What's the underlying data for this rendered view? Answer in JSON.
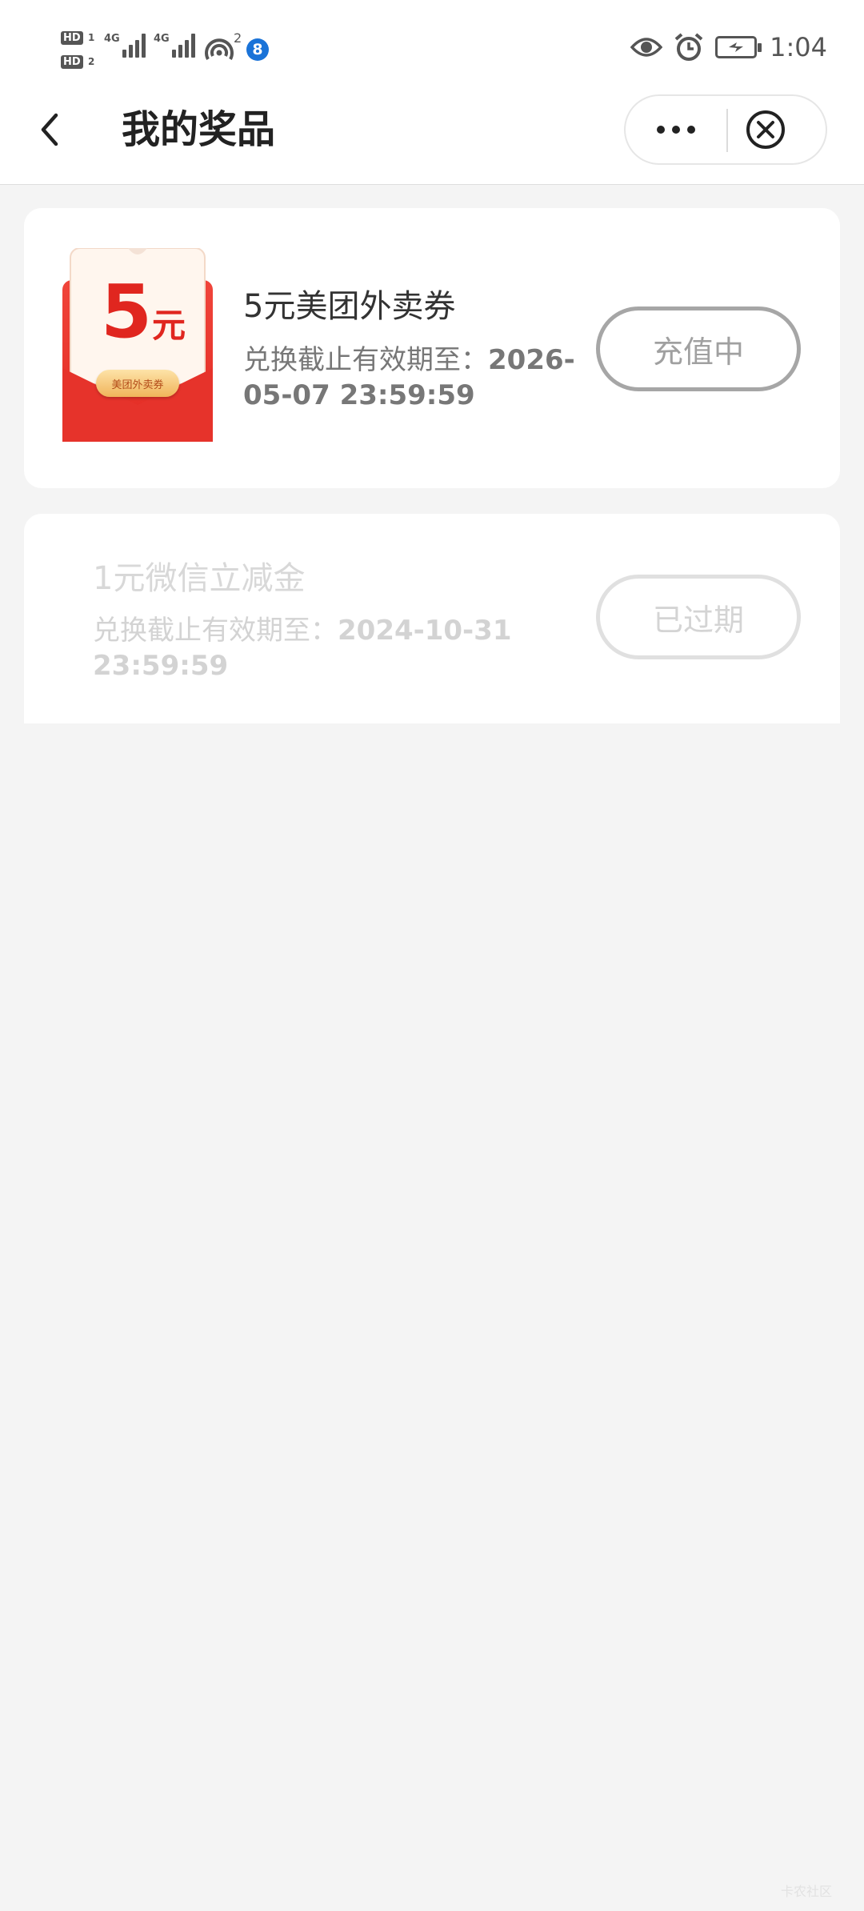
{
  "status_bar": {
    "hd1": "HD",
    "hd1_sub": "1",
    "hd2": "HD",
    "hd2_sub": "2",
    "net1": "4G",
    "net2": "4G",
    "hotspot_count": "2",
    "badge": "8",
    "time": "1:04",
    "icons": [
      "eye-icon",
      "alarm-icon",
      "battery-charging-icon"
    ]
  },
  "nav": {
    "title": "我的奖品",
    "back_icon": "chevron-left-icon",
    "more_icon": "more-dots-icon",
    "close_icon": "close-circle-icon"
  },
  "prizes": [
    {
      "name": "5元美团外卖券",
      "expiry_label": "兑换截止有效期至：",
      "expiry_value": "2026-05-07 23:59:59",
      "status": "充值中",
      "thumb": {
        "amount": "5",
        "unit": "元",
        "tag": "美团外卖券"
      }
    },
    {
      "name": "1元微信立减金",
      "expiry_label": "兑换截止有效期至：",
      "expiry_value": "2024-10-31 23:59:59",
      "status": "已过期"
    }
  ],
  "watermark": "卡农社区",
  "colors": {
    "thumb_red": "#e8322c",
    "thumb_cream": "#fff6ee",
    "badge_blue": "#1a73d8",
    "page_bg": "#f4f4f4"
  }
}
